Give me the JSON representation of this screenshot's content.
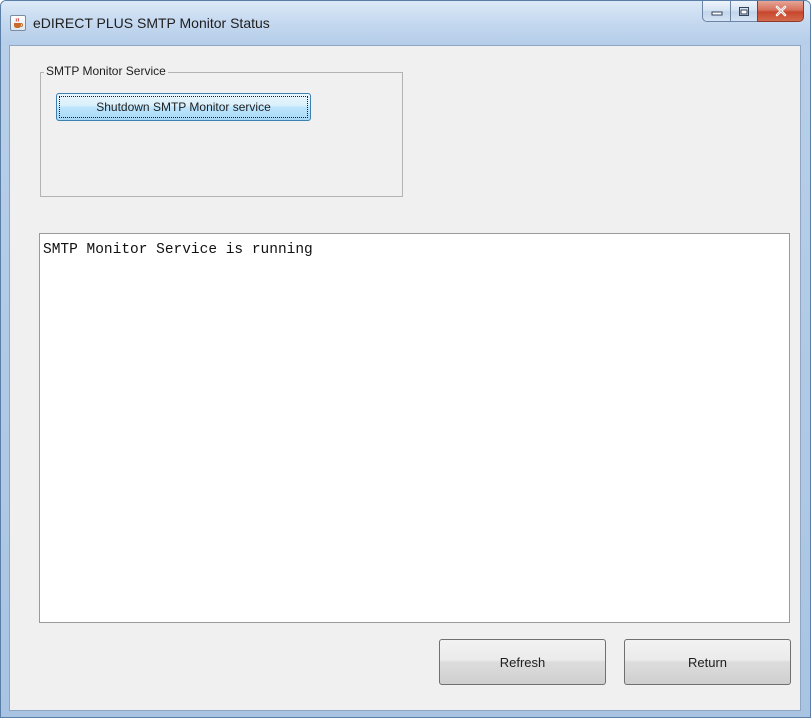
{
  "window": {
    "title": "eDIRECT PLUS SMTP Monitor Status",
    "icon": "java-cup-icon",
    "controls": [
      "minimize-icon",
      "maximize-icon",
      "close-icon"
    ]
  },
  "service_group": {
    "legend": "SMTP Monitor Service",
    "shutdown_label": "Shutdown SMTP Monitor service"
  },
  "status": {
    "text": "SMTP Monitor Service is running"
  },
  "actions": {
    "refresh_label": "Refresh",
    "return_label": "Return"
  },
  "colors": {
    "close_button": "#c7452c",
    "focused_button": "#bee6fd",
    "title_bar": "#c4d8ef"
  }
}
